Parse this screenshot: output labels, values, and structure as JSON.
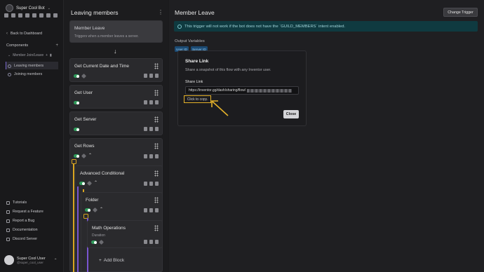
{
  "sidebar": {
    "bot_name": "Super Cool Bot",
    "back_label": "Back to Dashboard",
    "components_label": "Components",
    "group_label": "Member Join/Leave",
    "items": [
      {
        "label": "Leaving members",
        "active": true
      },
      {
        "label": "Joining members",
        "active": false
      }
    ],
    "footer_links": [
      "Tutorials",
      "Request a Feature",
      "Report a Bug",
      "Documentation",
      "Discord Server"
    ],
    "user": {
      "name": "Super Cool User",
      "handle": "@super_cool_user"
    }
  },
  "flow": {
    "title": "Leaving members",
    "trigger": {
      "title": "Member Leave",
      "subtitle": "Triggers when a member leaves a server."
    },
    "blocks": [
      {
        "title": "Get Current Date and Time"
      },
      {
        "title": "Get User"
      },
      {
        "title": "Get Server"
      },
      {
        "title": "Get Rows"
      },
      {
        "title": "Advanced Conditional"
      },
      {
        "title": "Folder"
      },
      {
        "title": "Math Operations",
        "subtitle": "Duration"
      }
    ],
    "add_block_label": "Add Block"
  },
  "main": {
    "title": "Member Leave",
    "change_trigger_label": "Change Trigger",
    "info_text": "This trigger will not work if the bot does not have the `GUILD_MEMBERS` intent enabled.",
    "output_label": "Output Variables",
    "variables": [
      "User ID",
      "Server ID"
    ]
  },
  "modal": {
    "title": "Share Link",
    "description": "Share a snapshot of this flow with any Inventor user.",
    "field_label": "Share Link",
    "field_value": "https://inventor.gg/dash/sharing/flow/",
    "copy_hint": "Click to copy.",
    "close_label": "Close"
  },
  "colors": {
    "accent_toggle": "#2f9a5a",
    "highlight": "#e5b22a",
    "info_bg": "#0f3a40",
    "var_chip": "#1b4a73"
  }
}
